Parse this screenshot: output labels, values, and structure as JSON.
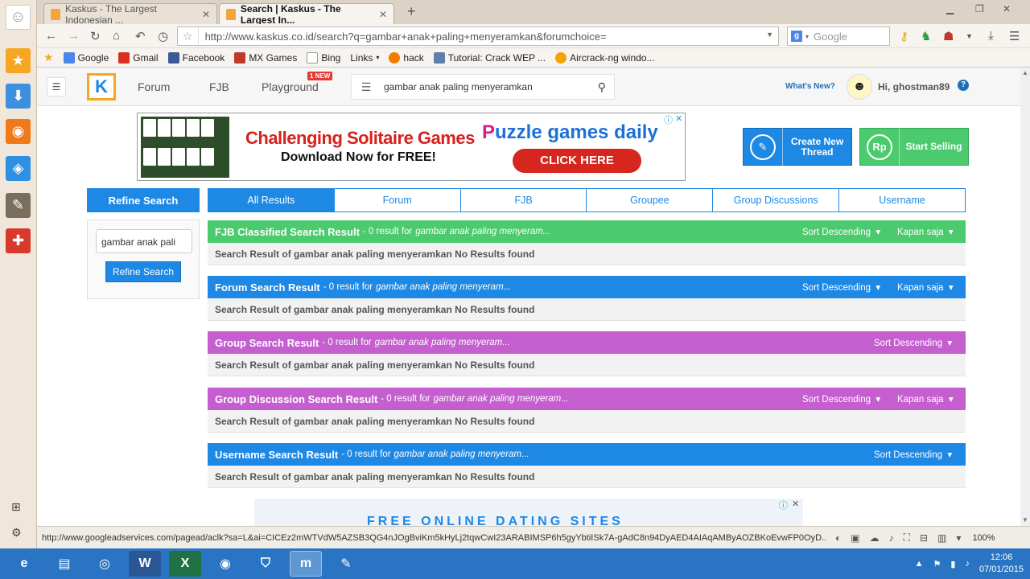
{
  "browser": {
    "tabs": [
      {
        "label": "Kaskus - The Largest Indonesian ...",
        "active": false
      },
      {
        "label": "Search | Kaskus - The Largest In...",
        "active": true
      }
    ],
    "new_tab": "+",
    "url": "http://www.kaskus.co.id/search?q=gambar+anak+paling+menyeramkan&forumchoice=",
    "search_engine": "Google",
    "bookmarks": [
      {
        "label": "Google",
        "color": "#4c86e8"
      },
      {
        "label": "Gmail",
        "color": "#d93025"
      },
      {
        "label": "Facebook",
        "color": "#3b5998"
      },
      {
        "label": "MX Games",
        "color": "#c0392b"
      },
      {
        "label": "Bing",
        "color": "#ffffff"
      },
      {
        "label": "Links",
        "color": ""
      },
      {
        "label": "hack",
        "color": "#f57c00"
      },
      {
        "label": "Tutorial: Crack WEP ...",
        "color": "#5d7fa8"
      },
      {
        "label": "Aircrack-ng windo...",
        "color": "#f4a300"
      }
    ],
    "status_url": "http://www.googleadservices.com/pagead/aclk?sa=L&ai=CICEz2mWTVdW5AZSB3QG4nJOgBviKm5kHyLj2tqwCwI23ARABIMSP6h5gyYbtiISk7A-gAdC8n94DyAED4AIAqAMByAOZBKoEvwFP0OyD...",
    "zoom": "100%"
  },
  "site": {
    "nav": {
      "forum": "Forum",
      "fjb": "FJB",
      "playground": "Playground",
      "new_badge": "1 NEW"
    },
    "search_query": "gambar anak paling menyeramkan",
    "whats_new": "What's New?",
    "greeting": "Hi, ghostman89",
    "help": "?"
  },
  "ad": {
    "title": "Challenging Solitaire Games",
    "subtitle": "Download Now for FREE!",
    "brand_p": "P",
    "brand_rest": "uzzle games daily",
    "cta": "CLICK HERE",
    "bottom_text": "FREE ONLINE DATING SITES"
  },
  "actions": {
    "create": "Create New Thread",
    "sell": "Start Selling",
    "sell_icon": "Rp"
  },
  "refine": {
    "header": "Refine Search",
    "input_value": "gambar anak pali",
    "button": "Refine Search"
  },
  "result_tabs": [
    "All Results",
    "Forum",
    "FJB",
    "Groupee",
    "Group Discussions",
    "Username"
  ],
  "sections": [
    {
      "title": "FJB Classified Search Result",
      "count": "- 0 result for",
      "term": "gambar anak paling menyeram...",
      "sort": "Sort Descending",
      "time": "Kapan saja",
      "body": "Search Result of gambar anak paling menyeramkan No Results found",
      "color": "#4cca6e"
    },
    {
      "title": "Forum Search Result",
      "count": "- 0 result for",
      "term": "gambar anak paling menyeram...",
      "sort": "Sort Descending",
      "time": "Kapan saja",
      "body": "Search Result of gambar anak paling menyeramkan No Results found",
      "color": "#1e88e5"
    },
    {
      "title": "Group Search Result",
      "count": "- 0 result for",
      "term": "gambar anak paling menyeram...",
      "sort": "Sort Descending",
      "time": "",
      "body": "Search Result of gambar anak paling menyeramkan No Results found",
      "color": "#c55fd0"
    },
    {
      "title": "Group Discussion Search Result",
      "count": "- 0 result for",
      "term": "gambar anak paling menyeram...",
      "sort": "Sort Descending",
      "time": "Kapan saja",
      "body": "Search Result of gambar anak paling menyeramkan No Results found",
      "color": "#c55fd0"
    },
    {
      "title": "Username Search Result",
      "count": "- 0 result for",
      "term": "gambar anak paling menyeram...",
      "sort": "Sort Descending",
      "time": "",
      "body": "Search Result of gambar anak paling menyeramkan No Results found",
      "color": "#1e88e5"
    }
  ],
  "taskbar": {
    "time": "12:06",
    "date": "07/01/2015"
  }
}
